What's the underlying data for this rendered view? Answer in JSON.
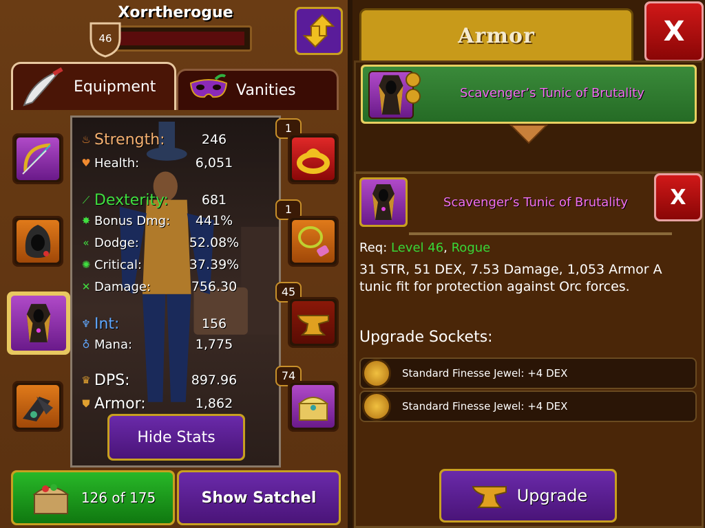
{
  "character": {
    "name": "Xorrtherogue",
    "level": "46",
    "xp_progress": 0.0
  },
  "tabs": {
    "equipment": "Equipment",
    "vanities": "Vanities"
  },
  "slots": {
    "ring_badge": "1",
    "amulet_badge": "1",
    "anvil_badge": "45",
    "chest_badge": "74"
  },
  "stats": [
    {
      "label": "Strength:",
      "value": "246",
      "icon": "flame-icon",
      "color": "#f4b070"
    },
    {
      "label": "Health:",
      "value": "6,051",
      "icon": "heart-icon",
      "color": "#ffffff"
    },
    {
      "label": "Dexterity:",
      "value": "681",
      "icon": "dexterity-icon",
      "color": "#40e040"
    },
    {
      "label": "Bonus Dmg:",
      "value": "441%",
      "icon": "burst-icon",
      "color": "#ffffff"
    },
    {
      "label": "Dodge:",
      "value": "52.08%",
      "icon": "chevrons-icon",
      "color": "#ffffff"
    },
    {
      "label": "Critical:",
      "value": "37.39%",
      "icon": "critical-icon",
      "color": "#ffffff"
    },
    {
      "label": "Damage:",
      "value": "756.30",
      "icon": "swords-icon",
      "color": "#ffffff"
    },
    {
      "label": "Int:",
      "value": "156",
      "icon": "int-icon",
      "color": "#60a8ff"
    },
    {
      "label": "Mana:",
      "value": "1,775",
      "icon": "potion-icon",
      "color": "#ffffff"
    },
    {
      "label": "DPS:",
      "value": "897.96",
      "icon": "dps-icon",
      "color": "#ffffff"
    },
    {
      "label": "Armor:",
      "value": "1,862",
      "icon": "shield-icon",
      "color": "#ffffff"
    }
  ],
  "buttons": {
    "hide_stats": "Hide Stats",
    "satchel_count": "126 of 175",
    "show_satchel": "Show Satchel",
    "upgrade": "Upgrade",
    "close": "X"
  },
  "armor": {
    "title": "Armor",
    "selected_item": "Scavenger’s Tunic of Brutality"
  },
  "detail": {
    "item_name": "Scavenger’s Tunic of Brutality",
    "req_prefix": "Req:",
    "req_level": "Level 46",
    "req_sep": ",",
    "req_class": "Rogue",
    "description": "31 STR, 51 DEX, 7.53 Damage, 1,053 Armor A tunic fit for protection against Orc forces.",
    "sockets_title": "Upgrade Sockets:",
    "sockets": [
      {
        "label": "Standard Finesse Jewel: +4 DEX"
      },
      {
        "label": "Standard Finesse Jewel: +4 DEX"
      }
    ]
  },
  "colors": {
    "panel_bg": "#5a3110",
    "gold_border": "#c8a020",
    "purple_button": "#5a1c9a",
    "green_selected": "#2f7a2f",
    "item_name_pink": "#f070f0",
    "req_green": "#38d838",
    "close_red": "#c01010"
  }
}
